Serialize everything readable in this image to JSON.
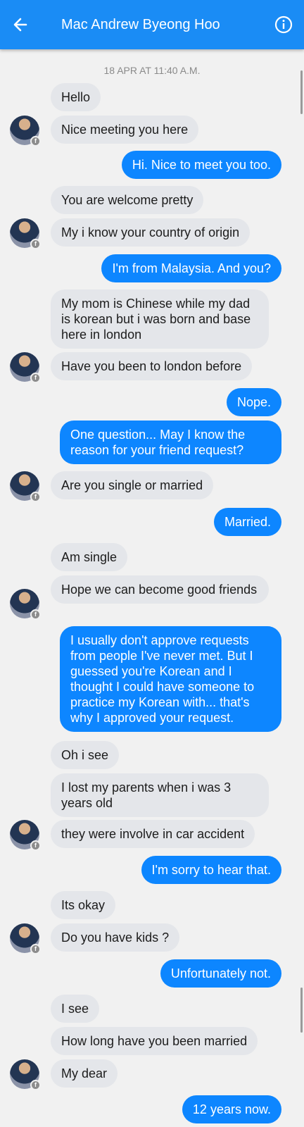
{
  "header": {
    "title": "Mac Andrew Byeong Hoo",
    "back_icon": "arrow-left-icon",
    "info_icon": "info-circle-icon",
    "color": "#1a8cf5"
  },
  "timestamp": "18 APR AT 11:40 A.M.",
  "messages": [
    {
      "side": "in",
      "text": "Hello"
    },
    {
      "side": "in",
      "text": "Nice meeting you here",
      "avatar": true
    },
    {
      "side": "out",
      "text": "Hi. Nice to meet you too."
    },
    {
      "side": "in",
      "text": "You are welcome pretty"
    },
    {
      "side": "in",
      "text": "My i know your country of origin",
      "avatar": true
    },
    {
      "side": "out",
      "text": "I'm from Malaysia. And you?"
    },
    {
      "side": "in",
      "text": "My mom is Chinese while my dad is korean but i was born and base here in london"
    },
    {
      "side": "in",
      "text": "Have you been to london before",
      "avatar": true
    },
    {
      "side": "out",
      "text": "Nope."
    },
    {
      "side": "out",
      "text": "One question... May I know the reason for your friend request?"
    },
    {
      "side": "in",
      "text": "Are you single or married",
      "avatar": true
    },
    {
      "side": "out",
      "text": "Married."
    },
    {
      "side": "in",
      "text": "Am single"
    },
    {
      "side": "in",
      "text": "Hope we can become good friends",
      "avatar": true
    },
    {
      "side": "out",
      "text": "I usually don't approve requests from people I've never met. But I guessed you're Korean and I thought I could have someone to practice my Korean with... that's why I approved your request."
    },
    {
      "side": "in",
      "text": "Oh i see"
    },
    {
      "side": "in",
      "text": "I lost my parents when i was 3 years old"
    },
    {
      "side": "in",
      "text": "they were involve in car accident",
      "avatar": true
    },
    {
      "side": "out",
      "text": "I'm sorry to hear that."
    },
    {
      "side": "in",
      "text": "Its okay"
    },
    {
      "side": "in",
      "text": "Do you have kids ?",
      "avatar": true
    },
    {
      "side": "out",
      "text": "Unfortunately not."
    },
    {
      "side": "in",
      "text": "I see"
    },
    {
      "side": "in",
      "text": "How long have you been married"
    },
    {
      "side": "in",
      "text": "My dear",
      "avatar": true
    },
    {
      "side": "out",
      "text": "12 years now."
    }
  ],
  "colors": {
    "incoming": "#e4e6ea",
    "outgoing": "#0d86ff",
    "background": "#f1f1f1"
  }
}
